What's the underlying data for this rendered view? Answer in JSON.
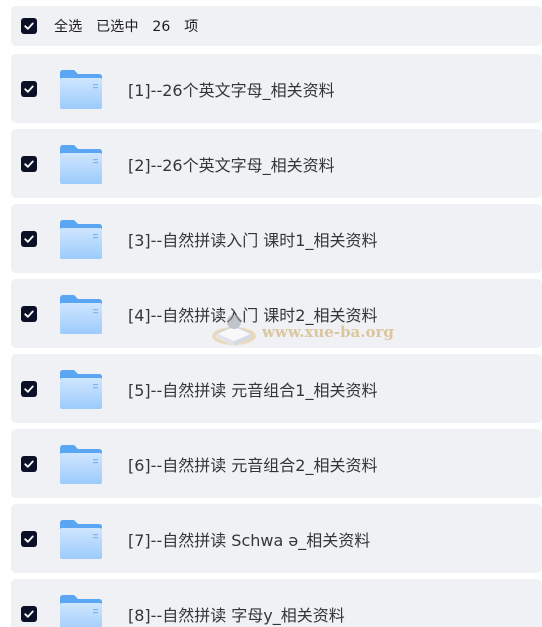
{
  "header": {
    "select_all_label": "全选",
    "selected_prefix": "已选中",
    "selected_count": "26",
    "selected_suffix": "项"
  },
  "items": [
    {
      "label": "[1]--26个英文字母_相关资料",
      "checked": true
    },
    {
      "label": "[2]--26个英文字母_相关资料",
      "checked": true
    },
    {
      "label": "[3]--自然拼读入门 课时1_相关资料",
      "checked": true
    },
    {
      "label": "[4]--自然拼读入门 课时2_相关资料",
      "checked": true
    },
    {
      "label": "[5]--自然拼读 元音组合1_相关资料",
      "checked": true
    },
    {
      "label": "[6]--自然拼读 元音组合2_相关资料",
      "checked": true
    },
    {
      "label": "[7]--自然拼读 Schwa ə_相关资料",
      "checked": true
    },
    {
      "label": "[8]--自然拼读 字母y_相关资料",
      "checked": true
    }
  ],
  "watermark": {
    "text": "www.xue-ba.org"
  },
  "colors": {
    "row_bg": "#f0f1f4",
    "checkbox_bg": "#0c1026",
    "folder_light": "#a8d4ff",
    "folder_dark": "#5aa6f2"
  },
  "icons": {
    "checkbox": "checkmark-icon",
    "folder": "folder-icon"
  }
}
